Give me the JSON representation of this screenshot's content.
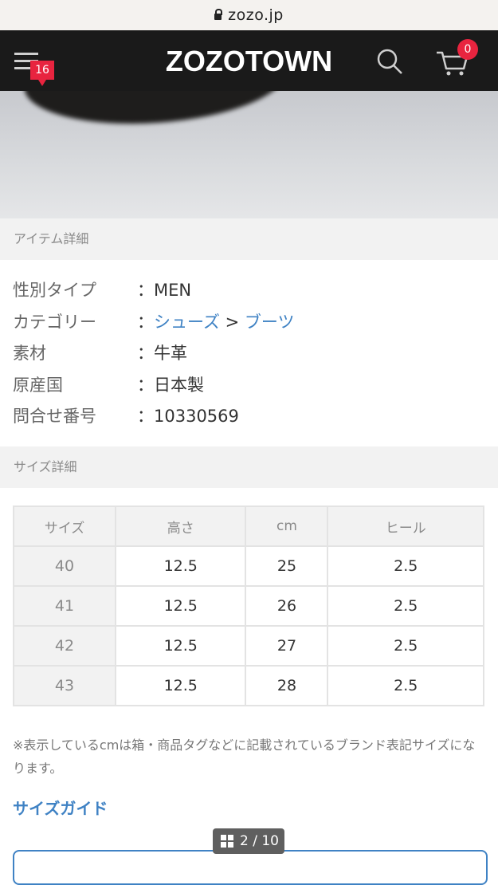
{
  "browser": {
    "url": "zozo.jp"
  },
  "header": {
    "logo": "ZOZOTOWN",
    "menu_badge": "16",
    "cart_count": "0"
  },
  "item_details": {
    "heading": "アイテム詳細",
    "rows": [
      {
        "label": "性別タイプ",
        "value": "：MEN"
      },
      {
        "label": "カテゴリー",
        "value_prefix": "：",
        "category": "シューズ",
        "separator": " > ",
        "subcategory": "ブーツ"
      },
      {
        "label": "素材",
        "value": "：牛革"
      },
      {
        "label": "原産国",
        "value": "：日本製"
      },
      {
        "label": "問合せ番号",
        "value": "：10330569"
      }
    ]
  },
  "size_details": {
    "heading": "サイズ詳細",
    "columns": [
      "サイズ",
      "高さ",
      "cm",
      "ヒール"
    ],
    "rows": [
      [
        "40",
        "12.5",
        "25",
        "2.5"
      ],
      [
        "41",
        "12.5",
        "26",
        "2.5"
      ],
      [
        "42",
        "12.5",
        "27",
        "2.5"
      ],
      [
        "43",
        "12.5",
        "28",
        "2.5"
      ]
    ],
    "note": "※表示しているcmは箱・商品タグなどに記載されているブランド表記サイズになります。",
    "guide_link": "サイズガイド"
  },
  "pager": {
    "label": "2 / 10"
  }
}
